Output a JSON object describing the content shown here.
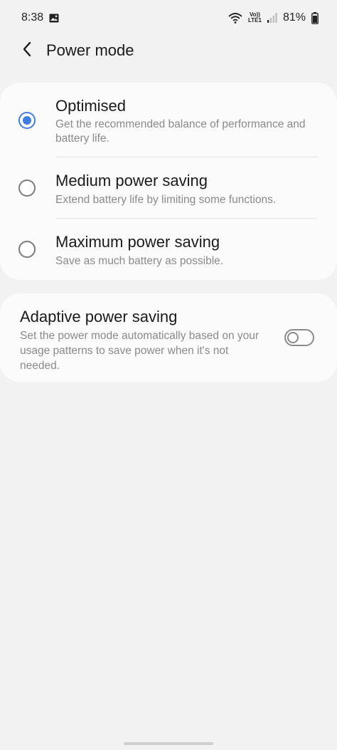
{
  "status_bar": {
    "time": "8:38",
    "gallery_icon": "image-icon",
    "wifi_icon": "wifi-icon",
    "volte_label": "Vo))",
    "lte_label": "LTE1",
    "signal_icon": "signal-icon",
    "battery_percent": "81%",
    "battery_icon": "battery-icon"
  },
  "header": {
    "back_icon": "chevron-left-icon",
    "title": "Power mode"
  },
  "modes": [
    {
      "title": "Optimised",
      "description": "Get the recommended balance of performance and battery life.",
      "selected": true
    },
    {
      "title": "Medium power saving",
      "description": "Extend battery life by limiting some functions.",
      "selected": false
    },
    {
      "title": "Maximum power saving",
      "description": "Save as much battery as possible.",
      "selected": false
    }
  ],
  "adaptive": {
    "title": "Adaptive power saving",
    "description": "Set the power mode automatically based on your usage patterns to save power when it's not needed.",
    "enabled": false
  },
  "colors": {
    "accent": "#3e7ee0",
    "background": "#f2f2f2",
    "card": "#fbfbfb",
    "secondary_text": "#8a8a8a"
  }
}
